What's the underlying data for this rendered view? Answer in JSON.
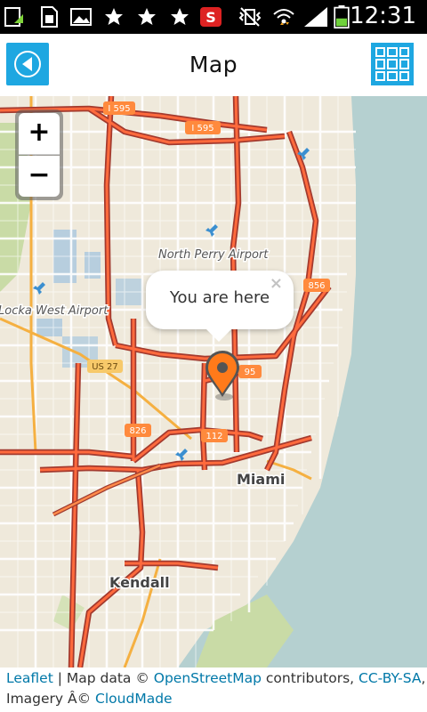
{
  "status_bar": {
    "time": "12:31",
    "icons": [
      "screenshot-icon",
      "sim-card-icon",
      "gallery-icon",
      "star-icon",
      "star-icon",
      "star-icon",
      "s-app-icon",
      "mute-vibrate-icon",
      "wifi-icon",
      "signal-icon",
      "battery-icon"
    ]
  },
  "app_bar": {
    "title": "Map",
    "back_icon": "back-arrow-icon",
    "menu_icon": "grid-menu-icon",
    "accent_color": "#1ea7e1"
  },
  "map": {
    "zoom_in_label": "+",
    "zoom_out_label": "−",
    "popup": {
      "text": "You are here",
      "close_label": "×"
    },
    "marker_color": "#ff7a1a",
    "labels": {
      "north_perry": "North Perry Airport",
      "opa_locka": "Locka West Airport",
      "miami": "Miami",
      "kendall": "Kendall"
    },
    "shields": {
      "i595_a": "I 595",
      "i595_b": "I 595",
      "r856": "856",
      "r95": "95",
      "us27": "US 27",
      "r826": "826",
      "r112": "112"
    }
  },
  "attribution": {
    "leaflet": "Leaflet",
    "sep": " | Map data © ",
    "osm": "OpenStreetMap",
    "contributors": " contributors, ",
    "license": "CC-BY-SA",
    "comma": ",",
    "imagery": "Imagery Â© ",
    "cloudmade": "CloudMade"
  }
}
